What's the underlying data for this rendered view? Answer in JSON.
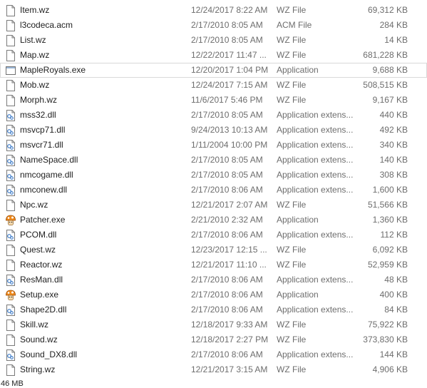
{
  "files": [
    {
      "name": "Item.wz",
      "date": "12/24/2017 8:22 AM",
      "type": "WZ File",
      "size": "69,312 KB",
      "icon": "file-icon"
    },
    {
      "name": "l3codeca.acm",
      "date": "2/17/2010 8:05 AM",
      "type": "ACM File",
      "size": "284 KB",
      "icon": "file-icon"
    },
    {
      "name": "List.wz",
      "date": "2/17/2010 8:05 AM",
      "type": "WZ File",
      "size": "14 KB",
      "icon": "file-icon"
    },
    {
      "name": "Map.wz",
      "date": "12/22/2017 11:47 ...",
      "type": "WZ File",
      "size": "681,228 KB",
      "icon": "file-icon"
    },
    {
      "name": "MapleRoyals.exe",
      "date": "12/20/2017 1:04 PM",
      "type": "Application",
      "size": "9,688 KB",
      "icon": "application-icon"
    },
    {
      "name": "Mob.wz",
      "date": "12/24/2017 7:15 AM",
      "type": "WZ File",
      "size": "508,515 KB",
      "icon": "file-icon"
    },
    {
      "name": "Morph.wz",
      "date": "11/6/2017 5:46 PM",
      "type": "WZ File",
      "size": "9,167 KB",
      "icon": "file-icon"
    },
    {
      "name": "mss32.dll",
      "date": "2/17/2010 8:05 AM",
      "type": "Application extens...",
      "size": "440 KB",
      "icon": "dll-icon"
    },
    {
      "name": "msvcp71.dll",
      "date": "9/24/2013 10:13 AM",
      "type": "Application extens...",
      "size": "492 KB",
      "icon": "dll-icon"
    },
    {
      "name": "msvcr71.dll",
      "date": "1/11/2004 10:00 PM",
      "type": "Application extens...",
      "size": "340 KB",
      "icon": "dll-icon"
    },
    {
      "name": "NameSpace.dll",
      "date": "2/17/2010 8:05 AM",
      "type": "Application extens...",
      "size": "140 KB",
      "icon": "dll-icon"
    },
    {
      "name": "nmcogame.dll",
      "date": "2/17/2010 8:05 AM",
      "type": "Application extens...",
      "size": "308 KB",
      "icon": "dll-icon"
    },
    {
      "name": "nmconew.dll",
      "date": "2/17/2010 8:06 AM",
      "type": "Application extens...",
      "size": "1,600 KB",
      "icon": "dll-icon"
    },
    {
      "name": "Npc.wz",
      "date": "12/21/2017 2:07 AM",
      "type": "WZ File",
      "size": "51,566 KB",
      "icon": "file-icon"
    },
    {
      "name": "Patcher.exe",
      "date": "2/21/2010 2:32 AM",
      "type": "Application",
      "size": "1,360 KB",
      "icon": "mushroom-icon"
    },
    {
      "name": "PCOM.dll",
      "date": "2/17/2010 8:06 AM",
      "type": "Application extens...",
      "size": "112 KB",
      "icon": "dll-icon"
    },
    {
      "name": "Quest.wz",
      "date": "12/23/2017 12:15 ...",
      "type": "WZ File",
      "size": "6,092 KB",
      "icon": "file-icon"
    },
    {
      "name": "Reactor.wz",
      "date": "12/21/2017 11:10 ...",
      "type": "WZ File",
      "size": "52,959 KB",
      "icon": "file-icon"
    },
    {
      "name": "ResMan.dll",
      "date": "2/17/2010 8:06 AM",
      "type": "Application extens...",
      "size": "48 KB",
      "icon": "dll-icon"
    },
    {
      "name": "Setup.exe",
      "date": "2/17/2010 8:06 AM",
      "type": "Application",
      "size": "400 KB",
      "icon": "mushroom-icon"
    },
    {
      "name": "Shape2D.dll",
      "date": "2/17/2010 8:06 AM",
      "type": "Application extens...",
      "size": "84 KB",
      "icon": "dll-icon"
    },
    {
      "name": "Skill.wz",
      "date": "12/18/2017 9:33 AM",
      "type": "WZ File",
      "size": "75,922 KB",
      "icon": "file-icon"
    },
    {
      "name": "Sound.wz",
      "date": "12/18/2017 2:27 PM",
      "type": "WZ File",
      "size": "373,830 KB",
      "icon": "file-icon"
    },
    {
      "name": "Sound_DX8.dll",
      "date": "2/17/2010 8:06 AM",
      "type": "Application extens...",
      "size": "144 KB",
      "icon": "dll-icon"
    },
    {
      "name": "String.wz",
      "date": "12/21/2017 3:15 AM",
      "type": "WZ File",
      "size": "4,906 KB",
      "icon": "file-icon"
    }
  ],
  "selected_index": 4,
  "status": {
    "text": "46 MB"
  },
  "colors": {
    "selection_border": "#d9d9d9",
    "secondary_text": "#6d6d6d"
  }
}
